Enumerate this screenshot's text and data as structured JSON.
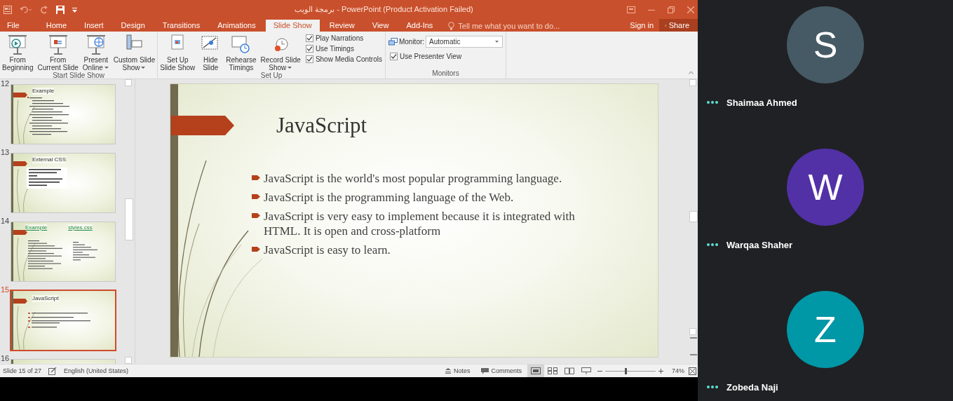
{
  "window": {
    "title": "برمجة الويب - PowerPoint (Product Activation Failed)"
  },
  "ribbon_tabs": [
    {
      "label": "File",
      "selected": false
    },
    {
      "label": "Home",
      "selected": false
    },
    {
      "label": "Insert",
      "selected": false
    },
    {
      "label": "Design",
      "selected": false
    },
    {
      "label": "Transitions",
      "selected": false
    },
    {
      "label": "Animations",
      "selected": false
    },
    {
      "label": "Slide Show",
      "selected": true
    },
    {
      "label": "Review",
      "selected": false
    },
    {
      "label": "View",
      "selected": false
    },
    {
      "label": "Add-Ins",
      "selected": false
    }
  ],
  "tell_me": "Tell me what you want to do...",
  "account": {
    "sign_in": "Sign in",
    "share": "Share"
  },
  "ribbon_groups": [
    {
      "label": "Start Slide Show",
      "items": [
        {
          "kind": "large",
          "lines": [
            "From",
            "Beginning"
          ],
          "dropdown": false
        },
        {
          "kind": "large",
          "lines": [
            "From",
            "Current Slide"
          ],
          "dropdown": false
        },
        {
          "kind": "large",
          "lines": [
            "Present",
            "Online"
          ],
          "dropdown": true
        },
        {
          "kind": "large",
          "lines": [
            "Custom Slide",
            "Show"
          ],
          "dropdown": true
        }
      ]
    },
    {
      "label": "Set Up",
      "items": [
        {
          "kind": "large",
          "lines": [
            "Set Up",
            "Slide Show"
          ],
          "dropdown": false
        },
        {
          "kind": "large",
          "lines": [
            "Hide",
            "Slide"
          ],
          "dropdown": false
        },
        {
          "kind": "large",
          "lines": [
            "Rehearse",
            "Timings"
          ],
          "dropdown": false
        },
        {
          "kind": "large",
          "lines": [
            "Record Slide",
            "Show"
          ],
          "dropdown": true
        },
        {
          "kind": "checks",
          "checks": [
            {
              "label": "Play Narrations",
              "checked": true
            },
            {
              "label": "Use Timings",
              "checked": true
            },
            {
              "label": "Show Media Controls",
              "checked": true
            }
          ]
        }
      ]
    },
    {
      "label": "Monitors",
      "items": [
        {
          "kind": "select",
          "label": "Monitor:",
          "value": "Automatic"
        },
        {
          "kind": "checks",
          "checks": [
            {
              "label": "Use Presenter View",
              "checked": true
            }
          ]
        }
      ]
    }
  ],
  "thumbnails": [
    {
      "number": "12",
      "titles": [
        "Example"
      ],
      "kind": "code",
      "selected": false
    },
    {
      "number": "13",
      "titles": [
        "External CSS"
      ],
      "kind": "bullets",
      "selected": false
    },
    {
      "number": "14",
      "titles": [
        "Example",
        "styles.css"
      ],
      "kind": "two-column",
      "selected": false
    },
    {
      "number": "15",
      "titles": [
        "JavaScript"
      ],
      "kind": "list",
      "selected": true
    },
    {
      "number": "16",
      "kind": "list",
      "selected": false
    }
  ],
  "slide": {
    "title": "JavaScript",
    "bullets": [
      "JavaScript is the world's most popular programming language.",
      "JavaScript is the programming language of the Web.",
      "JavaScript is very easy to implement because it is integrated with HTML. It is open and cross-platform",
      "JavaScript is easy to learn."
    ]
  },
  "status_bar": {
    "slide": "Slide 15 of 27",
    "language": "English (United States)",
    "notes": "Notes",
    "comments": "Comments",
    "views": [
      {
        "selected": true
      },
      {
        "selected": false
      },
      {
        "selected": false
      },
      {
        "selected": false
      }
    ],
    "zoom": {
      "level": 0.4
    },
    "zoom_label": "74%"
  },
  "participants": [
    {
      "initial": "S",
      "name": "Shaimaa Ahmed",
      "color": "#455a64"
    },
    {
      "initial": "W",
      "name": "Warqaa Shaher",
      "color": "#5231a7"
    },
    {
      "initial": "Z",
      "name": "Zobeda Naji",
      "color": "#0097a7"
    }
  ]
}
